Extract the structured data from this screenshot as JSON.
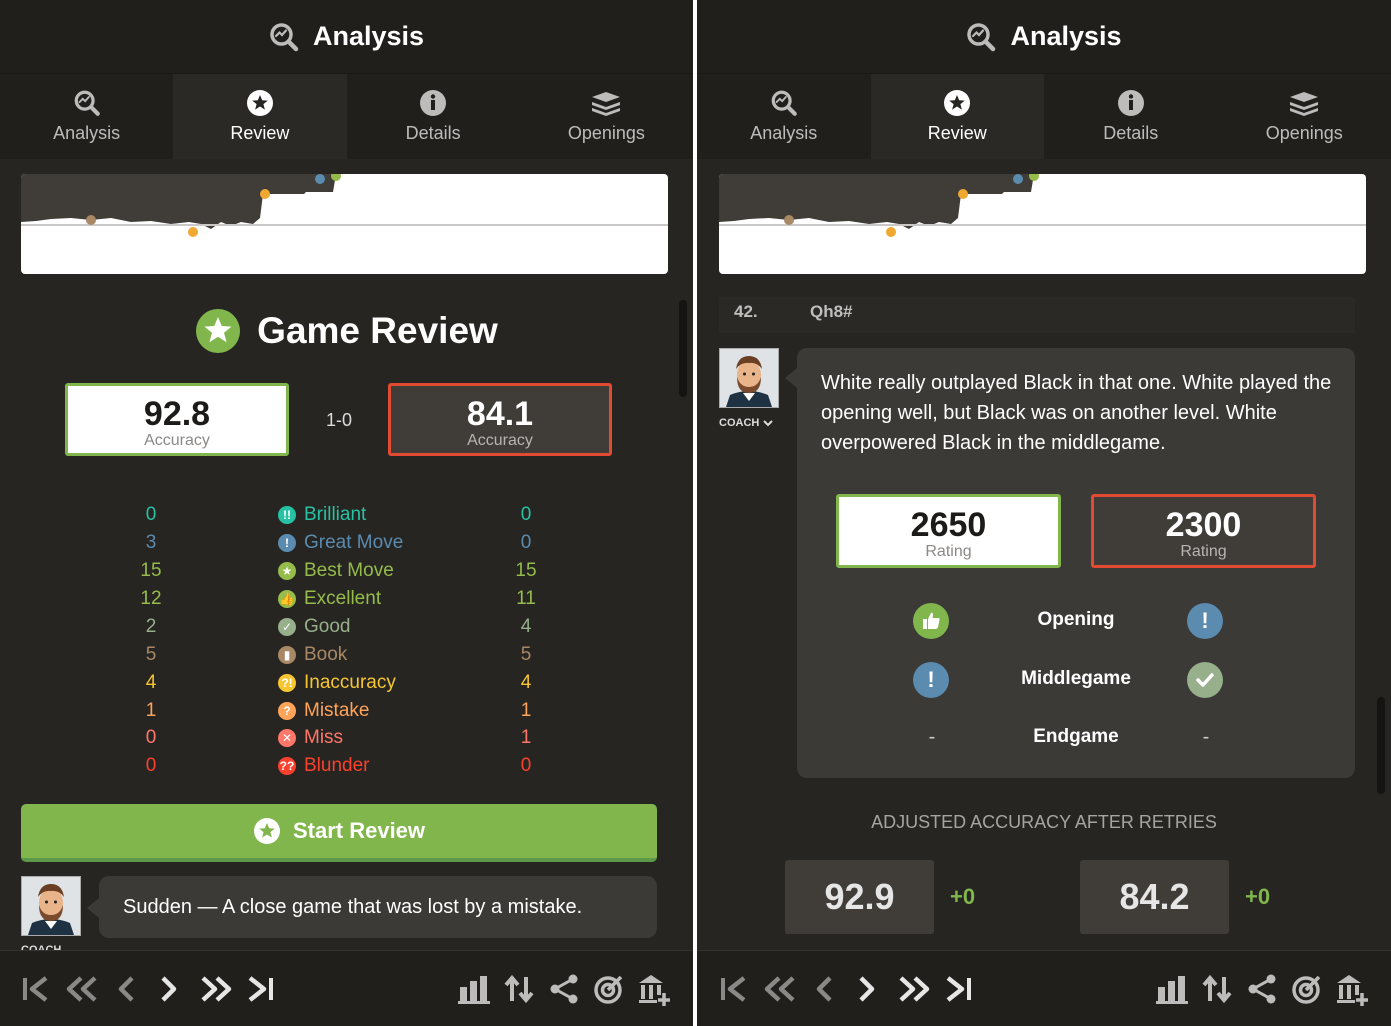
{
  "panel_title": "Analysis",
  "tabs": [
    {
      "label": "Analysis",
      "icon": "magnifier-icon"
    },
    {
      "label": "Review",
      "icon": "star-icon"
    },
    {
      "label": "Details",
      "icon": "info-icon"
    },
    {
      "label": "Openings",
      "icon": "book-stack-icon"
    }
  ],
  "active_tab": "Review",
  "game_review": {
    "title": "Game Review",
    "white_accuracy": "92.8",
    "black_accuracy": "84.1",
    "accuracy_label": "Accuracy",
    "result": "1-0"
  },
  "classifications": [
    {
      "label": "Brilliant",
      "white": "0",
      "black": "0",
      "color": "#26c2a3",
      "icon": "brilliant-icon",
      "glyph": "!!"
    },
    {
      "label": "Great Move",
      "white": "3",
      "black": "0",
      "color": "#5b8baf",
      "icon": "great-move-icon",
      "glyph": "!"
    },
    {
      "label": "Best Move",
      "white": "15",
      "black": "15",
      "color": "#95bb4a",
      "icon": "best-move-icon",
      "glyph": "★"
    },
    {
      "label": "Excellent",
      "white": "12",
      "black": "11",
      "color": "#96bc4b",
      "icon": "excellent-icon",
      "glyph": "👍"
    },
    {
      "label": "Good",
      "white": "2",
      "black": "4",
      "color": "#97af8b",
      "icon": "good-icon",
      "glyph": "✓"
    },
    {
      "label": "Book",
      "white": "5",
      "black": "5",
      "color": "#a88865",
      "icon": "book-icon",
      "glyph": "▮"
    },
    {
      "label": "Inaccuracy",
      "white": "4",
      "black": "4",
      "color": "#f7c631",
      "icon": "inaccuracy-icon",
      "glyph": "?!"
    },
    {
      "label": "Mistake",
      "white": "1",
      "black": "1",
      "color": "#ffa459",
      "icon": "mistake-icon",
      "glyph": "?"
    },
    {
      "label": "Miss",
      "white": "0",
      "black": "1",
      "color": "#ff7769",
      "icon": "miss-icon",
      "glyph": "✕"
    },
    {
      "label": "Blunder",
      "white": "0",
      "black": "0",
      "color": "#fa412d",
      "icon": "blunder-icon",
      "glyph": "??"
    }
  ],
  "start_review_label": "Start Review",
  "coach": {
    "label": "COACH",
    "short_message": "Sudden — A close game that was lost by a mistake.",
    "long_message": "White really outplayed Black in that one. White played the opening well, but Black was on another level. White overpowered Black in the middlegame."
  },
  "last_move": {
    "number": "42.",
    "san": "Qh8#"
  },
  "ratings": {
    "white": "2650",
    "black": "2300",
    "label": "Rating"
  },
  "phases": [
    {
      "name": "Opening",
      "white": "excellent-icon",
      "black": "great-move-icon"
    },
    {
      "name": "Middlegame",
      "white": "great-move-icon",
      "black": "good-icon"
    },
    {
      "name": "Endgame",
      "white": "-",
      "black": "-"
    }
  ],
  "adjusted": {
    "title": "ADJUSTED ACCURACY AFTER RETRIES",
    "white": "92.9",
    "white_delta": "+0",
    "black": "84.2",
    "black_delta": "+0"
  },
  "colors": {
    "panel_bg": "#262522",
    "header_bg": "#211f1c",
    "accent_green": "#81b64c",
    "accent_red": "#e34a32",
    "graph_black": "#403d39"
  }
}
